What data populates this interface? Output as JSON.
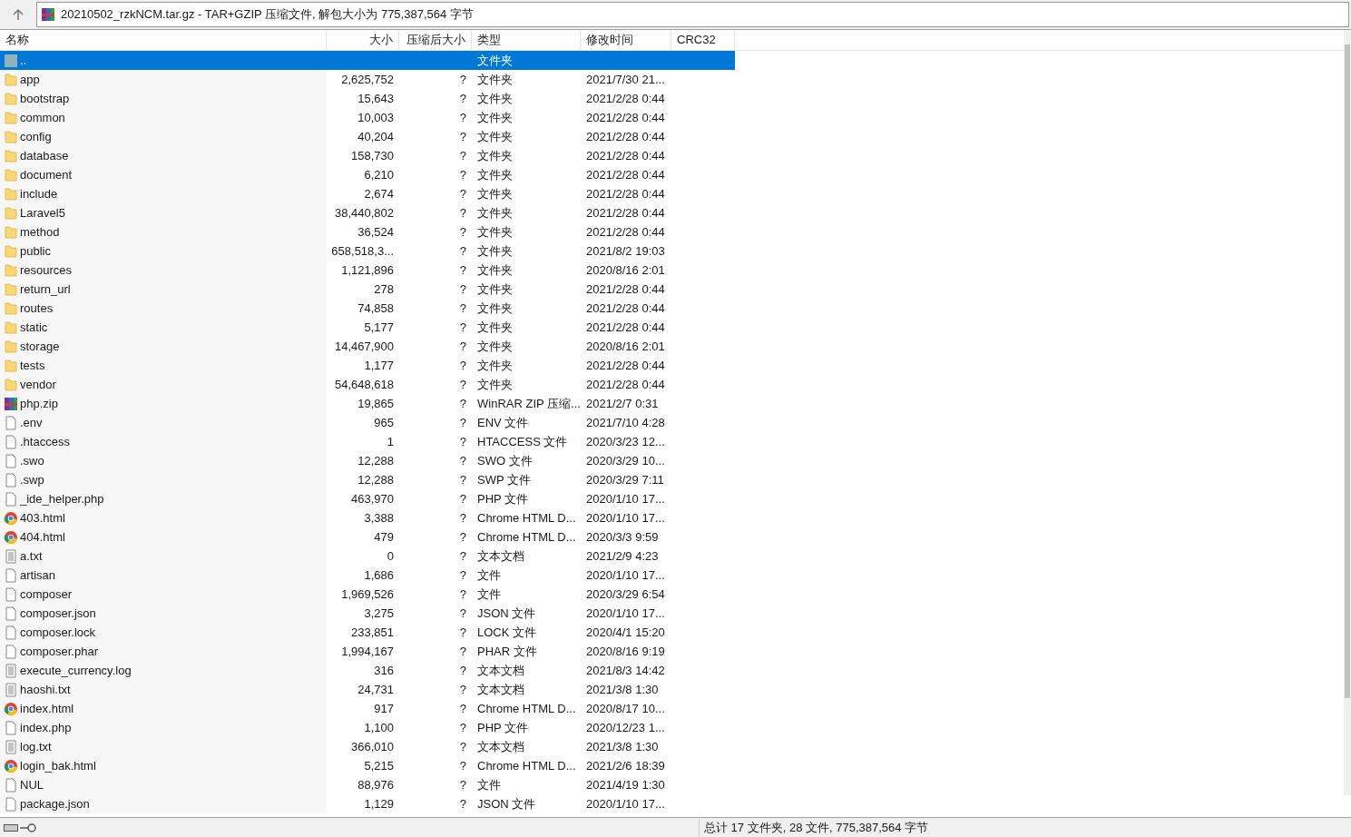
{
  "address_bar": {
    "title": "20210502_rzkNCM.tar.gz - TAR+GZIP 压缩文件, 解包大小为 775,387,564 字节"
  },
  "table": {
    "columns": [
      "名称",
      "大小",
      "压缩后大小",
      "类型",
      "修改时间",
      "CRC32"
    ],
    "rows": [
      {
        "kind": "parent",
        "name": "..",
        "size": "",
        "packed": "",
        "type": "文件夹",
        "modified": "",
        "selected": true
      },
      {
        "kind": "folder",
        "name": "app",
        "size": "2,625,752",
        "packed": "?",
        "type": "文件夹",
        "modified": "2021/7/30 21...",
        "selected": false
      },
      {
        "kind": "folder",
        "name": "bootstrap",
        "size": "15,643",
        "packed": "?",
        "type": "文件夹",
        "modified": "2021/2/28 0:44",
        "selected": false
      },
      {
        "kind": "folder",
        "name": "common",
        "size": "10,003",
        "packed": "?",
        "type": "文件夹",
        "modified": "2021/2/28 0:44",
        "selected": false
      },
      {
        "kind": "folder",
        "name": "config",
        "size": "40,204",
        "packed": "?",
        "type": "文件夹",
        "modified": "2021/2/28 0:44",
        "selected": false
      },
      {
        "kind": "folder",
        "name": "database",
        "size": "158,730",
        "packed": "?",
        "type": "文件夹",
        "modified": "2021/2/28 0:44",
        "selected": false
      },
      {
        "kind": "folder",
        "name": "document",
        "size": "6,210",
        "packed": "?",
        "type": "文件夹",
        "modified": "2021/2/28 0:44",
        "selected": false
      },
      {
        "kind": "folder",
        "name": "include",
        "size": "2,674",
        "packed": "?",
        "type": "文件夹",
        "modified": "2021/2/28 0:44",
        "selected": false
      },
      {
        "kind": "folder",
        "name": "Laravel5",
        "size": "38,440,802",
        "packed": "?",
        "type": "文件夹",
        "modified": "2021/2/28 0:44",
        "selected": false
      },
      {
        "kind": "folder",
        "name": "method",
        "size": "36,524",
        "packed": "?",
        "type": "文件夹",
        "modified": "2021/2/28 0:44",
        "selected": false
      },
      {
        "kind": "folder",
        "name": "public",
        "size": "658,518,3...",
        "packed": "?",
        "type": "文件夹",
        "modified": "2021/8/2 19:03",
        "selected": false
      },
      {
        "kind": "folder",
        "name": "resources",
        "size": "1,121,896",
        "packed": "?",
        "type": "文件夹",
        "modified": "2020/8/16 2:01",
        "selected": false
      },
      {
        "kind": "folder",
        "name": "return_url",
        "size": "278",
        "packed": "?",
        "type": "文件夹",
        "modified": "2021/2/28 0:44",
        "selected": false
      },
      {
        "kind": "folder",
        "name": "routes",
        "size": "74,858",
        "packed": "?",
        "type": "文件夹",
        "modified": "2021/2/28 0:44",
        "selected": false
      },
      {
        "kind": "folder",
        "name": "static",
        "size": "5,177",
        "packed": "?",
        "type": "文件夹",
        "modified": "2021/2/28 0:44",
        "selected": false
      },
      {
        "kind": "folder",
        "name": "storage",
        "size": "14,467,900",
        "packed": "?",
        "type": "文件夹",
        "modified": "2020/8/16 2:01",
        "selected": false
      },
      {
        "kind": "folder",
        "name": "tests",
        "size": "1,177",
        "packed": "?",
        "type": "文件夹",
        "modified": "2021/2/28 0:44",
        "selected": false
      },
      {
        "kind": "folder",
        "name": "vendor",
        "size": "54,648,618",
        "packed": "?",
        "type": "文件夹",
        "modified": "2021/2/28 0:44",
        "selected": false
      },
      {
        "kind": "archive",
        "name": "php.zip",
        "size": "19,865",
        "packed": "?",
        "type": "WinRAR ZIP 压缩...",
        "modified": "2021/2/7 0:31",
        "selected": false
      },
      {
        "kind": "file",
        "name": ".env",
        "size": "965",
        "packed": "?",
        "type": "ENV 文件",
        "modified": "2021/7/10 4:28",
        "selected": false
      },
      {
        "kind": "file",
        "name": ".htaccess",
        "size": "1",
        "packed": "?",
        "type": "HTACCESS 文件",
        "modified": "2020/3/23 12...",
        "selected": false
      },
      {
        "kind": "file",
        "name": ".swo",
        "size": "12,288",
        "packed": "?",
        "type": "SWO 文件",
        "modified": "2020/3/29 10...",
        "selected": false
      },
      {
        "kind": "file",
        "name": ".swp",
        "size": "12,288",
        "packed": "?",
        "type": "SWP 文件",
        "modified": "2020/3/29 7:11",
        "selected": false
      },
      {
        "kind": "file",
        "name": "_ide_helper.php",
        "size": "463,970",
        "packed": "?",
        "type": "PHP 文件",
        "modified": "2020/1/10 17...",
        "selected": false
      },
      {
        "kind": "html",
        "name": "403.html",
        "size": "3,388",
        "packed": "?",
        "type": "Chrome HTML D...",
        "modified": "2020/1/10 17...",
        "selected": false
      },
      {
        "kind": "html",
        "name": "404.html",
        "size": "479",
        "packed": "?",
        "type": "Chrome HTML D...",
        "modified": "2020/3/3 9:59",
        "selected": false
      },
      {
        "kind": "text",
        "name": "a.txt",
        "size": "0",
        "packed": "?",
        "type": "文本文档",
        "modified": "2021/2/9 4:23",
        "selected": false
      },
      {
        "kind": "file",
        "name": "artisan",
        "size": "1,686",
        "packed": "?",
        "type": "文件",
        "modified": "2020/1/10 17...",
        "selected": false
      },
      {
        "kind": "file",
        "name": "composer",
        "size": "1,969,526",
        "packed": "?",
        "type": "文件",
        "modified": "2020/3/29 6:54",
        "selected": false
      },
      {
        "kind": "file",
        "name": "composer.json",
        "size": "3,275",
        "packed": "?",
        "type": "JSON 文件",
        "modified": "2020/1/10 17...",
        "selected": false
      },
      {
        "kind": "file",
        "name": "composer.lock",
        "size": "233,851",
        "packed": "?",
        "type": "LOCK 文件",
        "modified": "2020/4/1 15:20",
        "selected": false
      },
      {
        "kind": "file",
        "name": "composer.phar",
        "size": "1,994,167",
        "packed": "?",
        "type": "PHAR 文件",
        "modified": "2020/8/16 9:19",
        "selected": false
      },
      {
        "kind": "text",
        "name": "execute_currency.log",
        "size": "316",
        "packed": "?",
        "type": "文本文档",
        "modified": "2021/8/3 14:42",
        "selected": false
      },
      {
        "kind": "text",
        "name": "haoshi.txt",
        "size": "24,731",
        "packed": "?",
        "type": "文本文档",
        "modified": "2021/3/8 1:30",
        "selected": false
      },
      {
        "kind": "html",
        "name": "index.html",
        "size": "917",
        "packed": "?",
        "type": "Chrome HTML D...",
        "modified": "2020/8/17 10...",
        "selected": false
      },
      {
        "kind": "file",
        "name": "index.php",
        "size": "1,100",
        "packed": "?",
        "type": "PHP 文件",
        "modified": "2020/12/23 1...",
        "selected": false
      },
      {
        "kind": "text",
        "name": "log.txt",
        "size": "366,010",
        "packed": "?",
        "type": "文本文档",
        "modified": "2021/3/8 1:30",
        "selected": false
      },
      {
        "kind": "html",
        "name": "login_bak.html",
        "size": "5,215",
        "packed": "?",
        "type": "Chrome HTML D...",
        "modified": "2021/2/6 18:39",
        "selected": false
      },
      {
        "kind": "file",
        "name": "NUL",
        "size": "88,976",
        "packed": "?",
        "type": "文件",
        "modified": "2021/4/19 1:30",
        "selected": false
      },
      {
        "kind": "file",
        "name": "package.json",
        "size": "1,129",
        "packed": "?",
        "type": "JSON 文件",
        "modified": "2020/1/10 17...",
        "selected": false
      }
    ]
  },
  "status_bar": {
    "summary": "总计 17 文件夹, 28 文件, 775,387,564 字节"
  }
}
